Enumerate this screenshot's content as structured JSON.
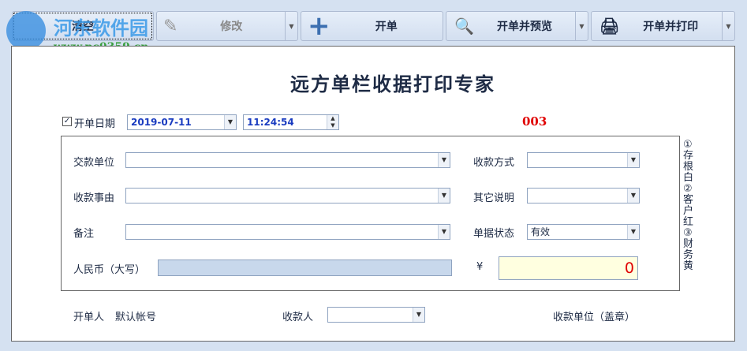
{
  "watermark": {
    "name": "河东软件园",
    "url": "www.pc0359.cn"
  },
  "toolbar": {
    "clear": "清空",
    "edit": "修改",
    "new": "开单",
    "new_preview": "开单并预览",
    "new_print": "开单并打印"
  },
  "form": {
    "title": "远方单栏收据打印专家",
    "date_label": "开单日期",
    "date_checked": true,
    "date": "2019-07-11",
    "time": "11:24:54",
    "number": "003",
    "payer_label": "交款单位",
    "payer": "",
    "method_label": "收款方式",
    "method": "",
    "reason_label": "收款事由",
    "reason": "",
    "other_label": "其它说明",
    "other": "",
    "note_label": "备注",
    "note": "",
    "status_label": "单据状态",
    "status": "有效",
    "rmb_label": "人民币（大写）",
    "rmb": "",
    "yen": "¥",
    "amount": "0",
    "side_text": "①存根白②客户红③财务黄",
    "issuer_label": "开单人",
    "issuer": "默认帐号",
    "receiver_label": "收款人",
    "receiver": "",
    "stamp_label": "收款单位（盖章）"
  },
  "colors": {
    "accent_red": "#e00000",
    "amount_bg": "#ffffe0",
    "rmb_bg": "#c8d8ec"
  }
}
